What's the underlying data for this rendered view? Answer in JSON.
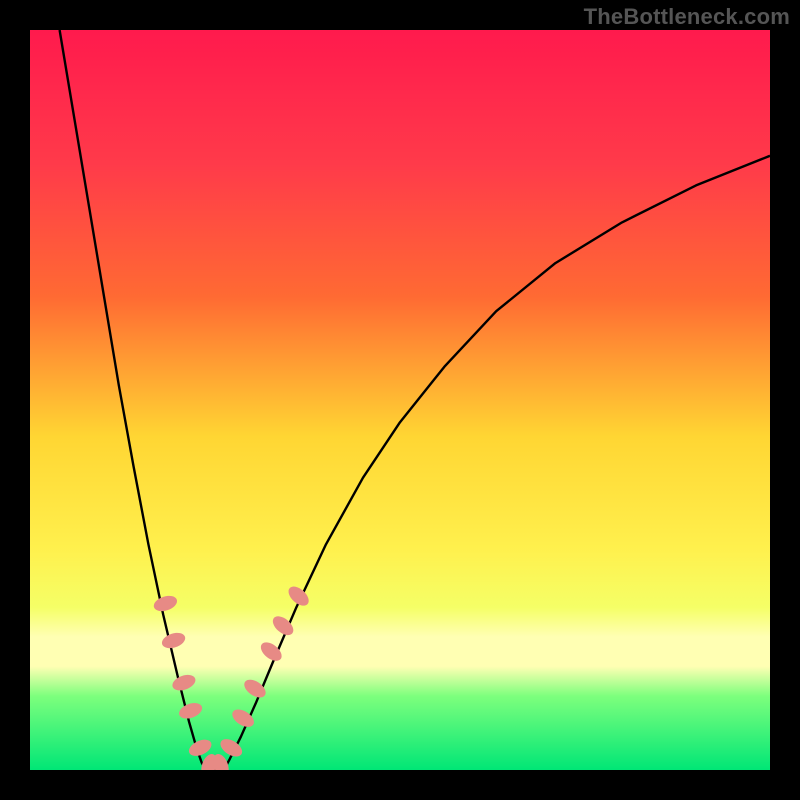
{
  "watermark": "TheBottleneck.com",
  "chart_data": {
    "type": "line",
    "title": "",
    "xlabel": "",
    "ylabel": "",
    "xlim": [
      0,
      100
    ],
    "ylim": [
      0,
      100
    ],
    "background_gradient": {
      "top": "#ff1a4d",
      "mid_top": "#ff6a33",
      "mid": "#ffd633",
      "mid_low": "#f5ff66",
      "band": "#ffffb3",
      "low": "#7dff7d",
      "bottom": "#00e676"
    },
    "series": [
      {
        "name": "curve-left",
        "x": [
          4.0,
          6.0,
          8.0,
          10.0,
          12.0,
          14.0,
          16.0,
          18.0,
          20.0,
          21.5,
          22.5,
          23.2,
          23.8
        ],
        "y": [
          100.0,
          88.0,
          76.0,
          64.0,
          52.0,
          41.0,
          30.5,
          21.0,
          12.5,
          6.5,
          3.0,
          1.0,
          0.0
        ]
      },
      {
        "name": "curve-right",
        "x": [
          26.2,
          27.0,
          28.5,
          30.5,
          33.0,
          36.0,
          40.0,
          45.0,
          50.0,
          56.0,
          63.0,
          71.0,
          80.0,
          90.0,
          100.0
        ],
        "y": [
          0.0,
          1.5,
          4.5,
          9.0,
          15.0,
          22.0,
          30.5,
          39.5,
          47.0,
          54.5,
          62.0,
          68.5,
          74.0,
          79.0,
          83.0
        ]
      }
    ],
    "flat_segment": {
      "x": [
        23.8,
        26.2
      ],
      "y": 0.0
    },
    "markers": {
      "color": "#e78a85",
      "rx": 7,
      "ry": 12,
      "points": [
        {
          "x": 18.3,
          "y": 22.5,
          "rot": 72
        },
        {
          "x": 19.4,
          "y": 17.5,
          "rot": 72
        },
        {
          "x": 20.8,
          "y": 11.8,
          "rot": 70
        },
        {
          "x": 21.7,
          "y": 8.0,
          "rot": 70
        },
        {
          "x": 23.0,
          "y": 3.0,
          "rot": 65
        },
        {
          "x": 24.2,
          "y": 0.6,
          "rot": 20
        },
        {
          "x": 25.8,
          "y": 0.6,
          "rot": -20
        },
        {
          "x": 27.2,
          "y": 3.0,
          "rot": -58
        },
        {
          "x": 28.8,
          "y": 7.0,
          "rot": -58
        },
        {
          "x": 30.4,
          "y": 11.0,
          "rot": -56
        },
        {
          "x": 32.6,
          "y": 16.0,
          "rot": -52
        },
        {
          "x": 34.2,
          "y": 19.5,
          "rot": -50
        },
        {
          "x": 36.3,
          "y": 23.5,
          "rot": -48
        }
      ]
    }
  }
}
